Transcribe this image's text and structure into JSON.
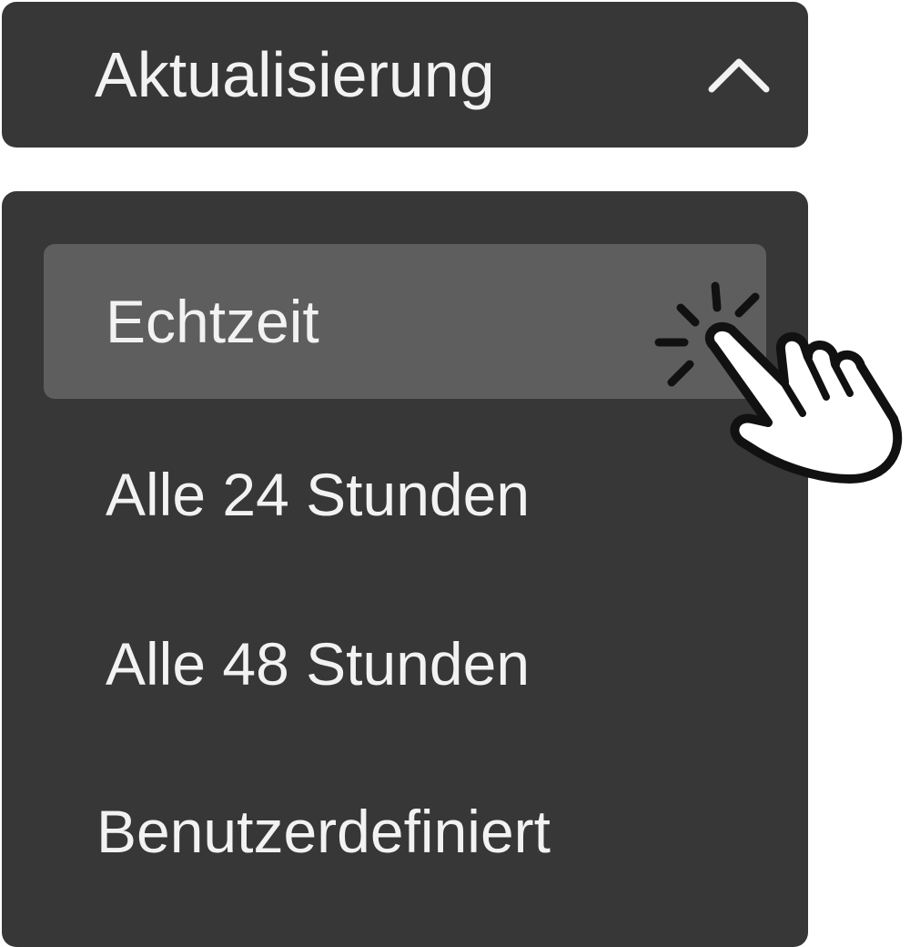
{
  "dropdown": {
    "label": "Aktualisierung",
    "expanded": true,
    "chevron_icon": "chevron-up-icon"
  },
  "menu": {
    "selected_index": 0,
    "items": [
      {
        "label": "Echtzeit"
      },
      {
        "label": "Alle 24 Stunden"
      },
      {
        "label": "Alle 48 Stunden"
      },
      {
        "label": "Benutzerdefiniert"
      }
    ]
  },
  "cursor": {
    "icon": "pointer-hand-click-icon"
  },
  "colors": {
    "panel_bg": "#373737",
    "selected_bg": "#5e5e5e",
    "text": "#f2f2f2"
  }
}
